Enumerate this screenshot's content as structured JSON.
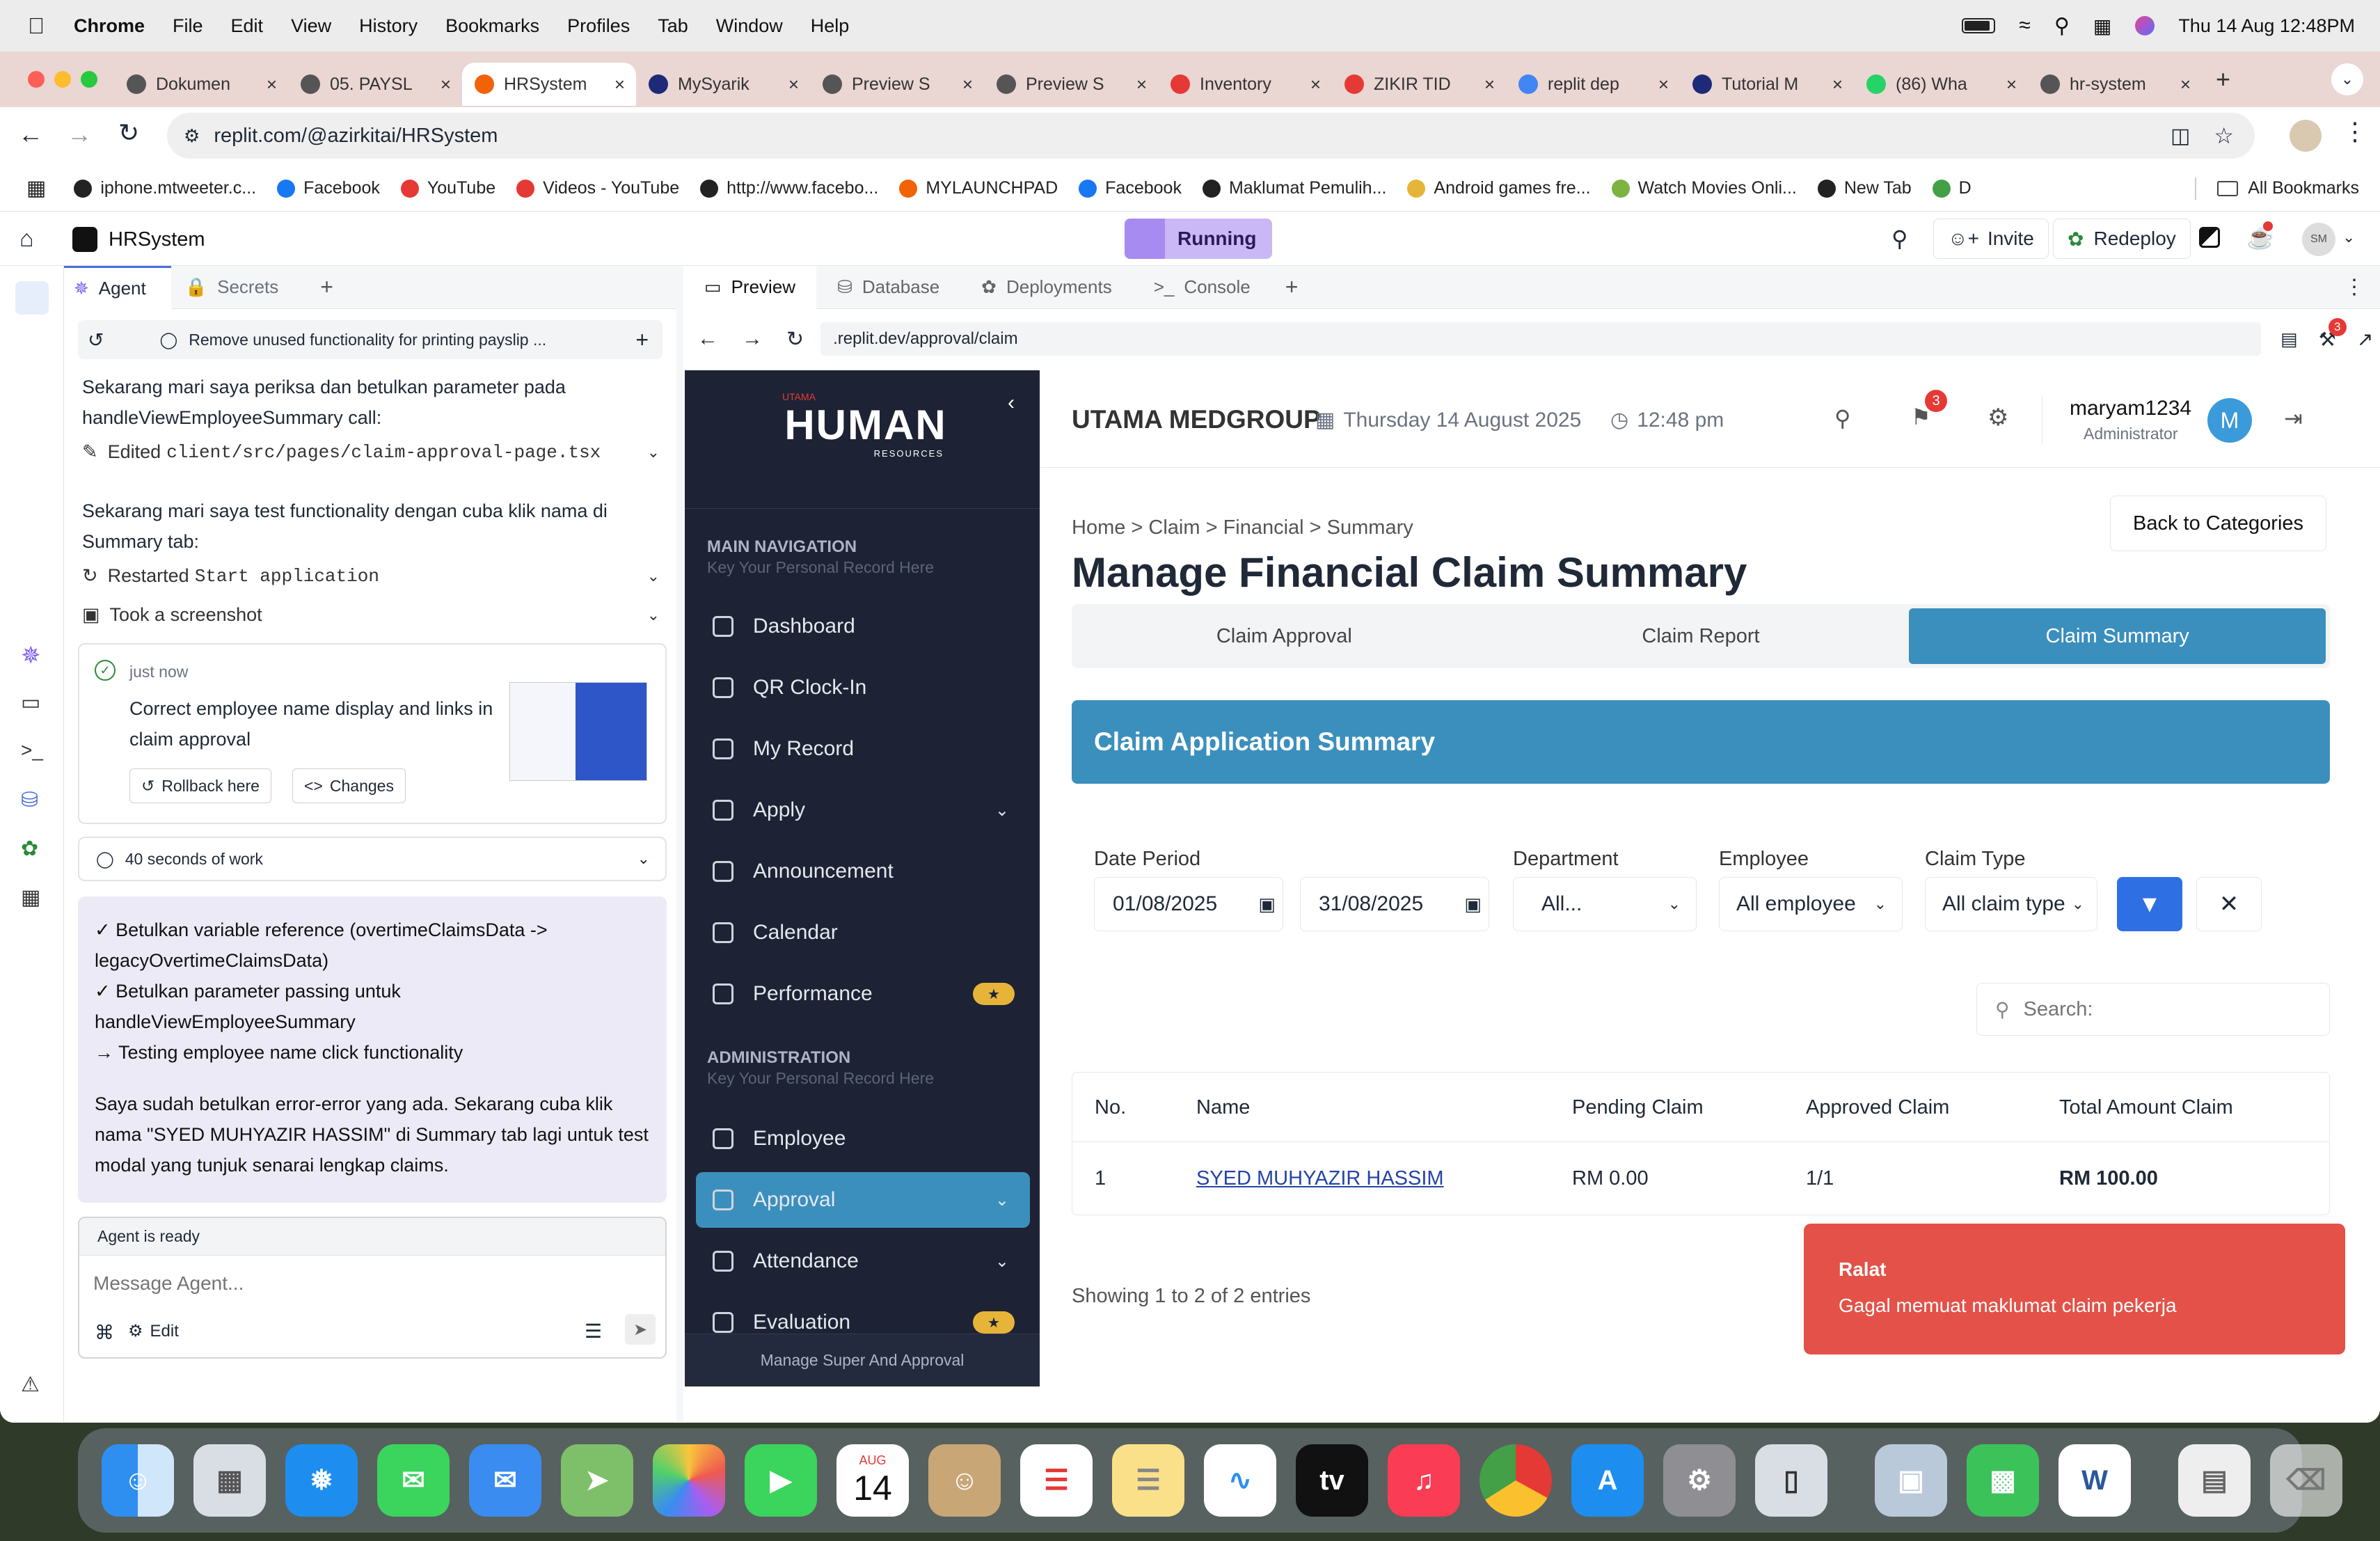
{
  "menubar": {
    "app": "Chrome",
    "items": [
      "File",
      "Edit",
      "View",
      "History",
      "Bookmarks",
      "Profiles",
      "Tab",
      "Window",
      "Help"
    ],
    "clock": "Thu 14 Aug  12:48PM"
  },
  "tabs": [
    {
      "label": "Dokumen",
      "color": "#555"
    },
    {
      "label": "05. PAYSL",
      "color": "#555"
    },
    {
      "label": "HRSystem",
      "color": "#f26207",
      "active": true
    },
    {
      "label": "MySyarik",
      "color": "#1e2a78"
    },
    {
      "label": "Preview S",
      "color": "#555"
    },
    {
      "label": "Preview S",
      "color": "#555"
    },
    {
      "label": "Inventory",
      "color": "#e53935"
    },
    {
      "label": "ZIKIR TID",
      "color": "#e53935"
    },
    {
      "label": "replit dep",
      "color": "#4285f4"
    },
    {
      "label": "Tutorial M",
      "color": "#1e2a78"
    },
    {
      "label": "(86) Wha",
      "color": "#25d366"
    },
    {
      "label": "hr-system",
      "color": "#555"
    }
  ],
  "url": "replit.com/@azirkitai/HRSystem",
  "bookmarks": [
    {
      "label": "iphone.mtweeter.c...",
      "color": "#222"
    },
    {
      "label": "Facebook",
      "color": "#1877f2"
    },
    {
      "label": "YouTube",
      "color": "#e53935"
    },
    {
      "label": "Videos - YouTube",
      "color": "#e53935"
    },
    {
      "label": "http://www.facebo...",
      "color": "#222"
    },
    {
      "label": "MYLAUNCHPAD",
      "color": "#f26207"
    },
    {
      "label": "Facebook",
      "color": "#1877f2"
    },
    {
      "label": "Maklumat Pemulih...",
      "color": "#222"
    },
    {
      "label": "Android games fre...",
      "color": "#e7b43a"
    },
    {
      "label": "Watch Movies Onli...",
      "color": "#7cb342"
    },
    {
      "label": "New Tab",
      "color": "#222"
    },
    {
      "label": "D",
      "color": "#43a047"
    }
  ],
  "bookmarks_all": "All Bookmarks",
  "replit": {
    "project": "HRSystem",
    "run_status": "Running",
    "invite": "Invite",
    "redeploy": "Redeploy",
    "avatar": "SM",
    "agent_tabs": [
      "Agent",
      "Secrets"
    ],
    "preview_tabs": [
      "Preview",
      "Database",
      "Deployments",
      "Console"
    ],
    "preview_url": ".replit.dev/approval/claim",
    "preview_badge": "3"
  },
  "agent": {
    "thread_title": "Remove unused functionality for printing payslip ...",
    "msg1": "Sekarang mari saya periksa dan betulkan parameter pada handleViewEmployeeSummary call:",
    "edited_prefix": "Edited ",
    "edited_file": "client/src/pages/claim-approval-page.tsx",
    "msg2": "Sekarang mari saya test functionality dengan cuba klik nama di Summary tab:",
    "restarted_prefix": "Restarted ",
    "restarted_code": "Start application",
    "screenshot": "Took a screenshot",
    "checkpoint_time": "just now",
    "checkpoint_text": "Correct employee name display and links in claim approval",
    "rollback": "Rollback here",
    "changes": "Changes",
    "work_time": "40 seconds of work",
    "summary_lines": [
      "✓ Betulkan variable reference (overtimeClaimsData -> legacyOvertimeClaimsData)",
      "✓ Betulkan parameter passing untuk handleViewEmployeeSummary",
      "→ Testing employee name click functionality"
    ],
    "summary_text": "Saya sudah betulkan error-error yang ada. Sekarang cuba klik nama \"SYED MUHYAZIR HASSIM\" di Summary tab lagi untuk test modal yang tunjuk senarai lengkap claims.",
    "status": "Agent is ready",
    "input_placeholder": "Message Agent...",
    "edit": "Edit"
  },
  "app": {
    "logo_small": "UTAMA",
    "logo_main": "HUMAN",
    "logo_sub": "RESOURCES",
    "company": "UTAMA MEDGROUP",
    "date": "Thursday 14 August 2025",
    "time": "12:48 pm",
    "notif_count": "3",
    "user": "maryam1234",
    "role": "Administrator",
    "avatar": "M",
    "nav_main_title": "MAIN NAVIGATION",
    "nav_main_sub": "Key Your Personal Record Here",
    "nav_main": [
      {
        "label": "Dashboard",
        "icon": "grid-icon"
      },
      {
        "label": "QR Clock-In",
        "icon": "qr-icon"
      },
      {
        "label": "My Record",
        "icon": "file-icon"
      },
      {
        "label": "Apply",
        "icon": "file-icon",
        "chevron": true
      },
      {
        "label": "Announcement",
        "icon": "megaphone-icon"
      },
      {
        "label": "Calendar",
        "icon": "calendar-icon"
      },
      {
        "label": "Performance",
        "icon": "trend-icon",
        "star": true
      }
    ],
    "nav_admin_title": "ADMINISTRATION",
    "nav_admin_sub": "Key Your Personal Record Here",
    "nav_admin": [
      {
        "label": "Employee",
        "icon": "users-icon"
      },
      {
        "label": "Approval",
        "icon": "check-square-icon",
        "chevron": true,
        "active": true
      },
      {
        "label": "Attendance",
        "icon": "clock-icon",
        "chevron": true
      },
      {
        "label": "Evaluation",
        "icon": "bar-chart-icon",
        "star": true
      }
    ],
    "sidebar_footer": "Manage Super And Approval",
    "breadcrumb": "Home > Claim > Financial > Summary",
    "page_title": "Manage Financial Claim Summary",
    "back_button": "Back to Categories",
    "tabs": [
      "Claim Approval",
      "Claim Report",
      "Claim Summary"
    ],
    "section_title": "Claim Application Summary",
    "filters": {
      "date_label": "Date Period",
      "date_from": "01/08/2025",
      "date_to": "31/08/2025",
      "dept_label": "Department",
      "dept_value": "All...",
      "emp_label": "Employee",
      "emp_value": "All employee",
      "type_label": "Claim Type",
      "type_value": "All claim type"
    },
    "search_placeholder": "Search:",
    "table_headers": [
      "No.",
      "Name",
      "Pending Claim",
      "Approved Claim",
      "Total Amount Claim"
    ],
    "table_rows": [
      {
        "no": "1",
        "name": "SYED MUHYAZIR HASSIM",
        "pending": "RM 0.00",
        "approved": "1/1",
        "total": "RM 100.00"
      }
    ],
    "entries": "Showing 1 to 2 of 2 entries",
    "toast_title": "Ralat",
    "toast_msg": "Gagal memuat maklumat claim pekerja"
  },
  "dock": {
    "calendar_month": "AUG",
    "calendar_day": "14"
  },
  "colors": {
    "accent": "#3b8fbd",
    "sidebar": "#1d2334",
    "toast": "#e35148",
    "filter_button": "#2f6fe4",
    "running": "#c9b8f5"
  }
}
